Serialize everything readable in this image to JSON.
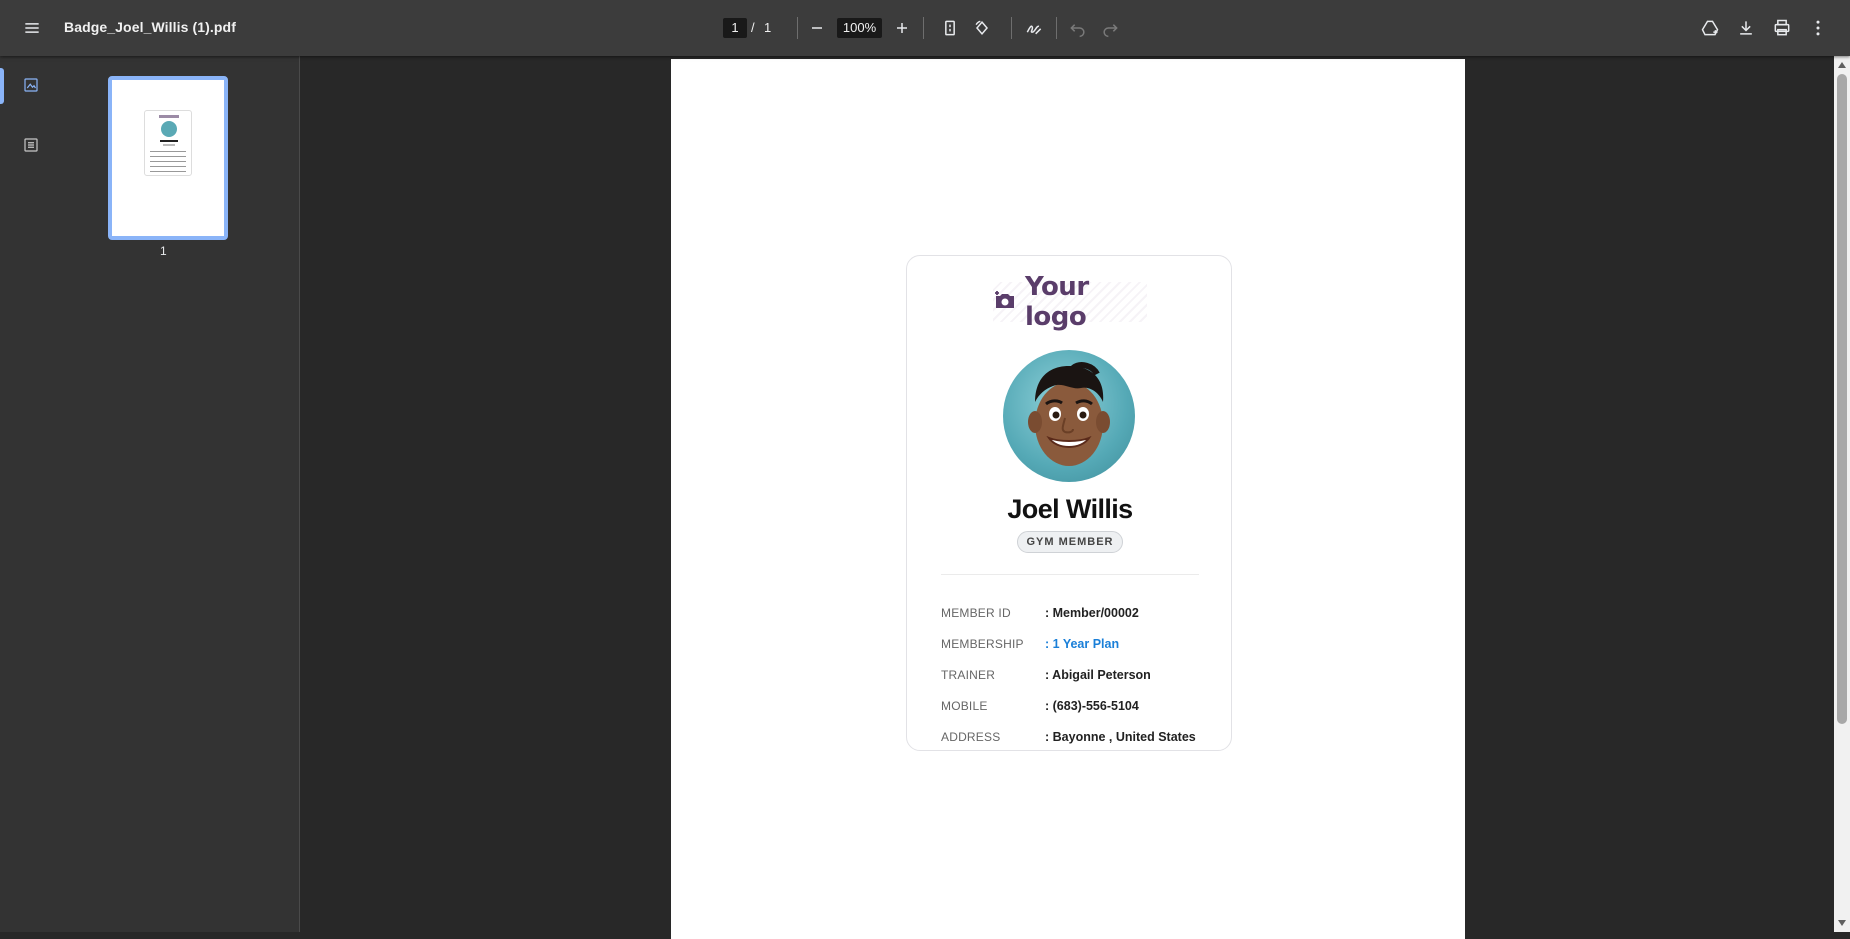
{
  "toolbar": {
    "menu_icon": "menu-icon",
    "file_title": "Badge_Joel_Willis (1).pdf",
    "current_page": "1",
    "page_separator": "/",
    "total_pages": "1",
    "zoom": "100%",
    "icons": [
      "minus-icon",
      "plus-icon",
      "fit-page-icon",
      "rotate-icon",
      "annotate-icon",
      "undo-icon",
      "redo-icon",
      "drive-save-icon",
      "download-icon",
      "print-icon",
      "more-icon"
    ]
  },
  "sidebar": {
    "tabs": [
      {
        "name": "thumbnails",
        "icon": "image-icon",
        "active": true
      },
      {
        "name": "outline",
        "icon": "outline-icon",
        "active": false
      }
    ],
    "thumbnail_label": "1"
  },
  "badge": {
    "logo_text": "Your logo",
    "logo_icon": "add-photo-icon",
    "name": "Joel Willis",
    "role": "GYM MEMBER",
    "fields": [
      {
        "key": "MEMBER ID",
        "value": ": Member/00002",
        "link": false
      },
      {
        "key": "MEMBERSHIP",
        "value": ": 1 Year Plan",
        "link": true
      },
      {
        "key": "TRAINER",
        "value": ": Abigail Peterson",
        "link": false
      },
      {
        "key": "MOBILE",
        "value": ": (683)-556-5104",
        "link": false
      },
      {
        "key": "ADDRESS",
        "value": ": Bayonne , United States",
        "link": false
      }
    ]
  },
  "colors": {
    "toolbar_bg": "#3c3c3c",
    "viewer_bg": "#282828",
    "accent": "#8ab4f8",
    "logo": "#5a3d6a",
    "link": "#1a7fd8"
  }
}
